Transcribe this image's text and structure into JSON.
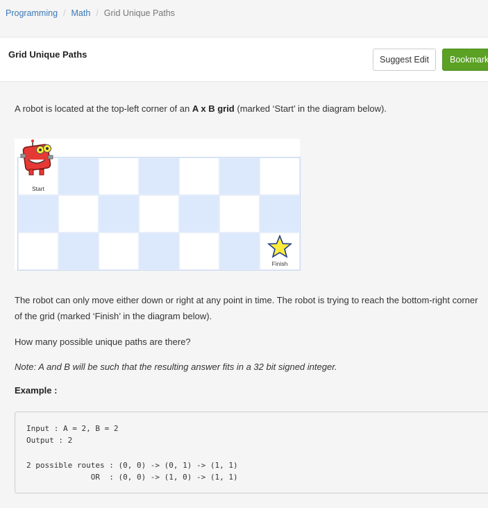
{
  "breadcrumb": {
    "items": [
      "Programming",
      "Math"
    ],
    "current": "Grid Unique Paths",
    "separator": "/"
  },
  "header": {
    "title": "Grid Unique Paths",
    "suggest_edit_label": "Suggest Edit",
    "bookmark_label": "Bookmark"
  },
  "problem": {
    "intro_prefix": "A robot is located at the top-left corner of an ",
    "intro_bold": "A x B grid",
    "intro_suffix": " (marked ‘Start’ in the diagram below).",
    "movement": "The robot can only move either down or right at any point in time. The robot is trying to reach the bottom-right corner of the grid (marked ‘Finish’ in the diagram below).",
    "question": "How many possible unique paths are there?",
    "note": "Note: A and B will be such that the resulting answer fits in a 32 bit signed integer.",
    "example_label": "Example :"
  },
  "diagram": {
    "rows": 3,
    "cols": 7,
    "start_label": "Start",
    "finish_label": "Finish",
    "colors": {
      "light_cell": "#dce8fb",
      "robot": "#e53935",
      "star": "#ffeb3b"
    }
  },
  "example": {
    "lines": [
      "Input : A = 2, B = 2",
      "Output : 2",
      "",
      "2 possible routes : (0, 0) -> (0, 1) -> (1, 1)",
      "              OR  : (0, 0) -> (1, 0) -> (1, 1)"
    ]
  }
}
